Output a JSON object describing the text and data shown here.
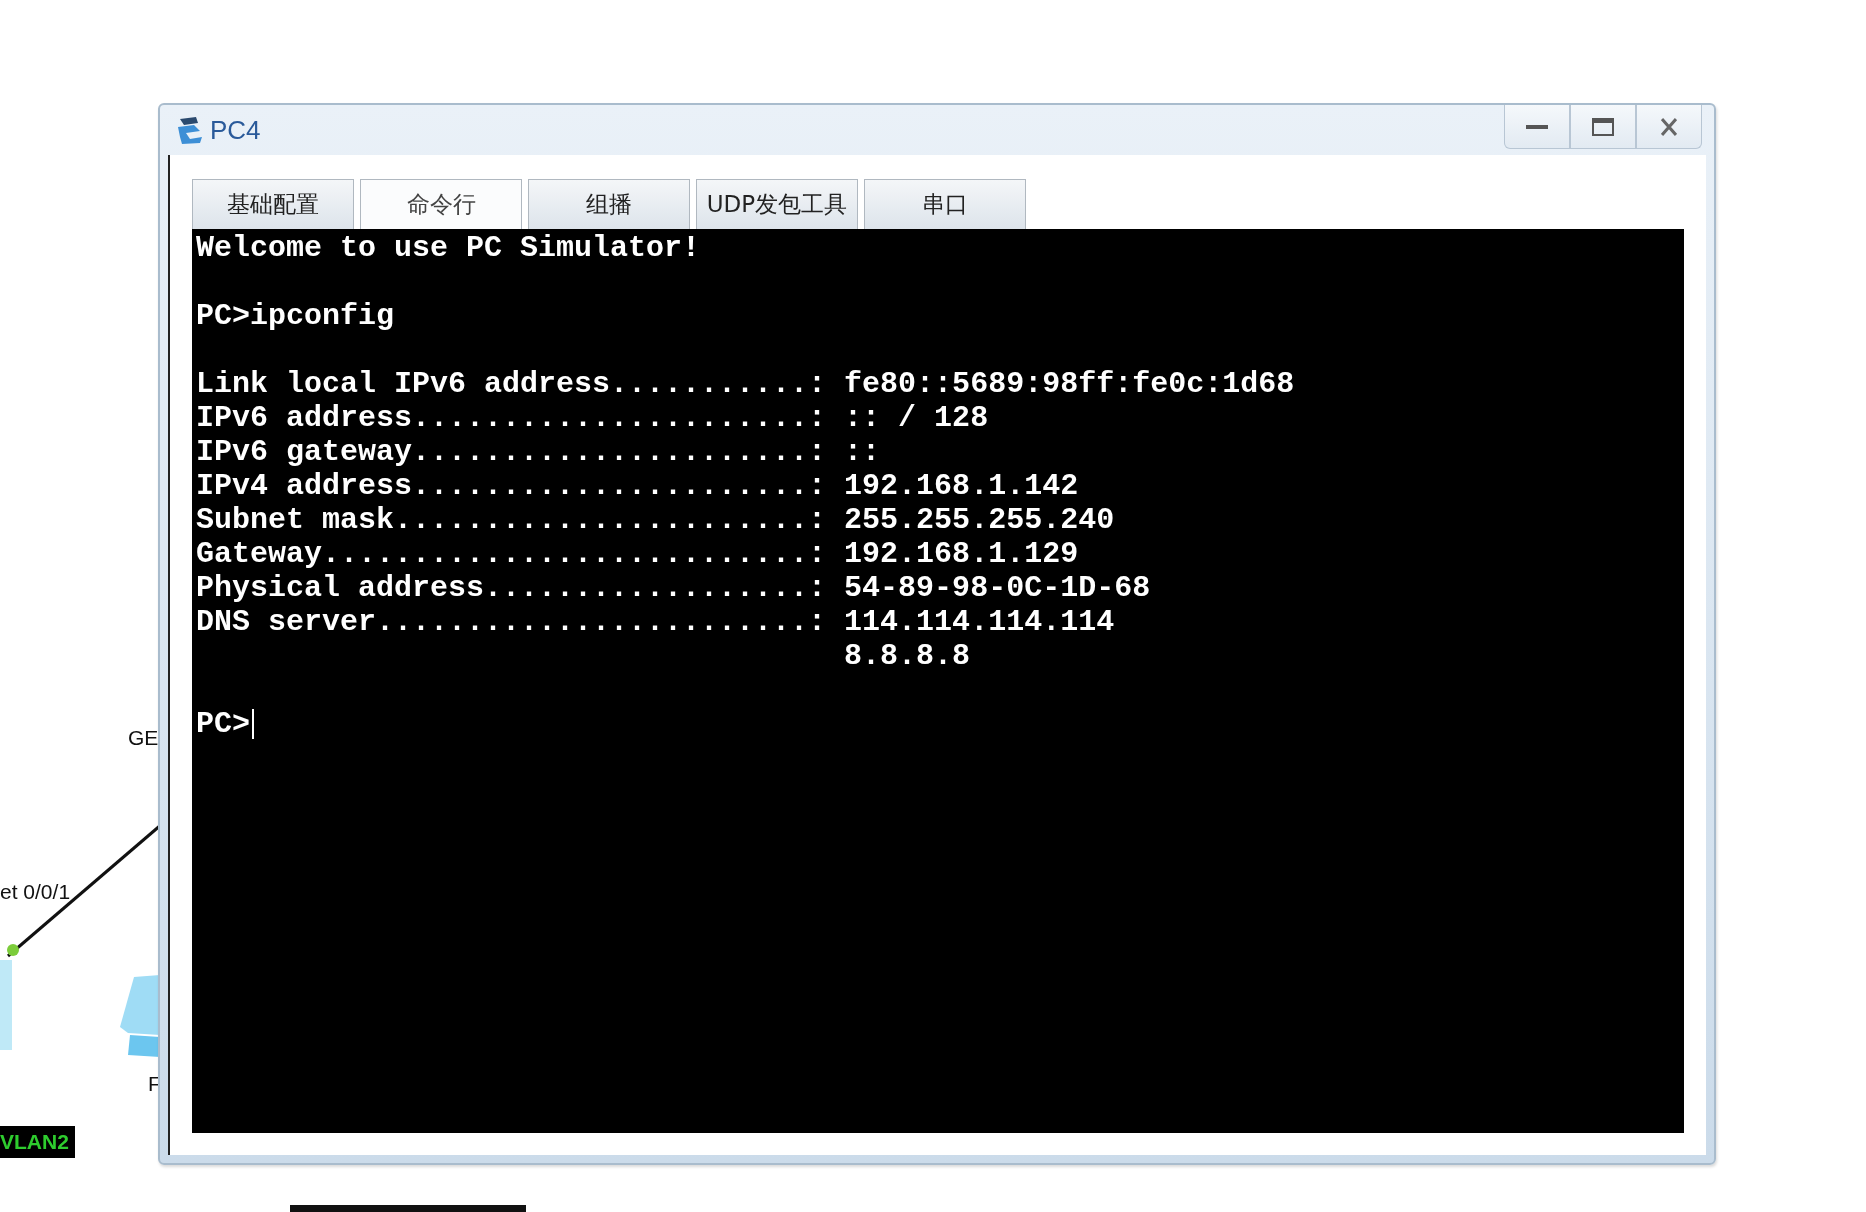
{
  "canvas": {
    "labels": [
      {
        "text": "GE"
      },
      {
        "text": "et 0/0/1"
      },
      {
        "text": "F"
      }
    ],
    "vlan_tag": "VLAN2"
  },
  "window": {
    "title": "PC4",
    "tabs": [
      {
        "label": "基础配置",
        "selected": false
      },
      {
        "label": "命令行",
        "selected": true
      },
      {
        "label": "组播",
        "selected": false
      },
      {
        "label": "UDP发包工具",
        "selected": false
      },
      {
        "label": "串口",
        "selected": false
      }
    ],
    "terminal": {
      "blocks": [
        [
          "Welcome to use PC Simulator!"
        ],
        [
          "PC>ipconfig"
        ],
        [
          "Link local IPv6 address...........: fe80::5689:98ff:fe0c:1d68",
          "IPv6 address......................: :: / 128",
          "IPv6 gateway......................: ::",
          "IPv4 address......................: 192.168.1.142",
          "Subnet mask.......................: 255.255.255.240",
          "Gateway...........................: 192.168.1.129",
          "Physical address..................: 54-89-98-0C-1D-68",
          "DNS server........................: 114.114.114.114",
          "                                    8.8.8.8"
        ],
        [
          "PC>"
        ]
      ],
      "cursor": true
    }
  }
}
